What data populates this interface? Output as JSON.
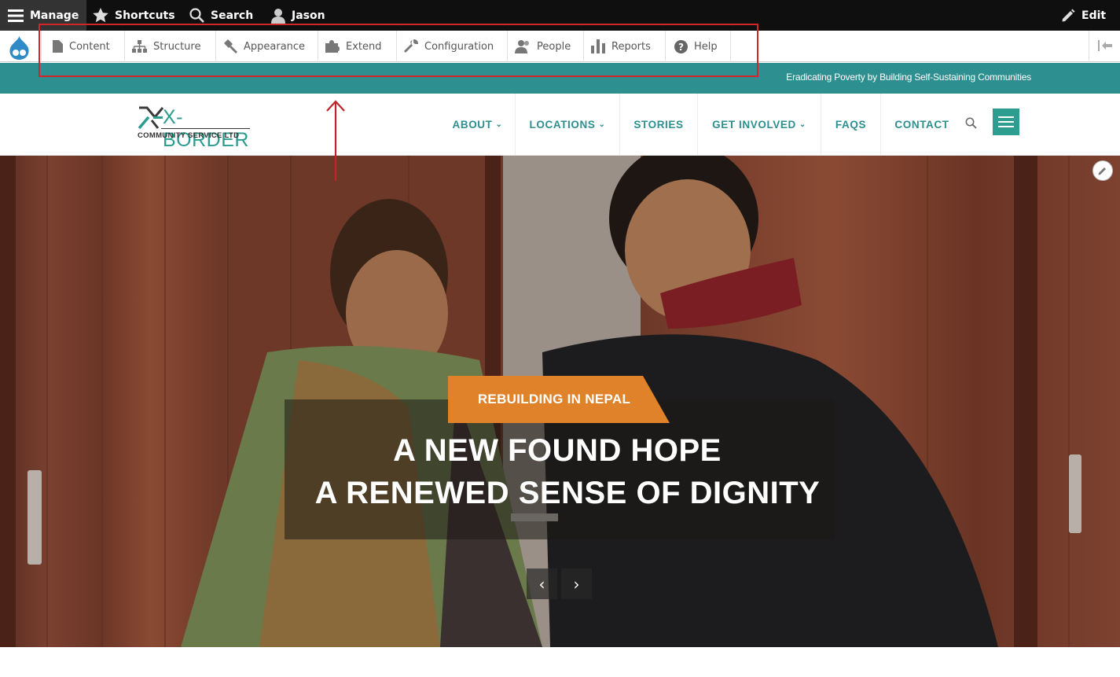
{
  "admin_bar": {
    "manage": "Manage",
    "shortcuts": "Shortcuts",
    "search": "Search",
    "user": "Jason",
    "edit": "Edit"
  },
  "tray": {
    "items": [
      {
        "label": "Content",
        "icon": "file-icon"
      },
      {
        "label": "Structure",
        "icon": "sitemap-icon"
      },
      {
        "label": "Appearance",
        "icon": "brush-icon"
      },
      {
        "label": "Extend",
        "icon": "puzzle-icon"
      },
      {
        "label": "Configuration",
        "icon": "wrench-icon"
      },
      {
        "label": "People",
        "icon": "people-icon"
      },
      {
        "label": "Reports",
        "icon": "bar-chart-icon"
      },
      {
        "label": "Help",
        "icon": "help-icon"
      }
    ]
  },
  "tagline": "Eradicating Poverty by Building Self-Sustaining Communities",
  "logo": {
    "name": "X-BORDER",
    "sub": "COMMUNITY SERVICE LTD"
  },
  "nav": {
    "items": [
      {
        "label": "ABOUT",
        "has_dropdown": true
      },
      {
        "label": "LOCATIONS",
        "has_dropdown": true
      },
      {
        "label": "STORIES",
        "has_dropdown": false
      },
      {
        "label": "GET INVOLVED",
        "has_dropdown": true
      },
      {
        "label": "FAQS",
        "has_dropdown": false
      },
      {
        "label": "CONTACT",
        "has_dropdown": false
      }
    ]
  },
  "hero": {
    "badge": "REBUILDING IN NEPAL",
    "headline_line1": "A NEW FOUND HOPE",
    "headline_line2": "A RENEWED SENSE OF DIGNITY",
    "prev": "‹",
    "next": "›"
  },
  "colors": {
    "teal": "#2d8f8f",
    "badge_orange": "#e0822a",
    "annotation_red": "#d0262a"
  }
}
